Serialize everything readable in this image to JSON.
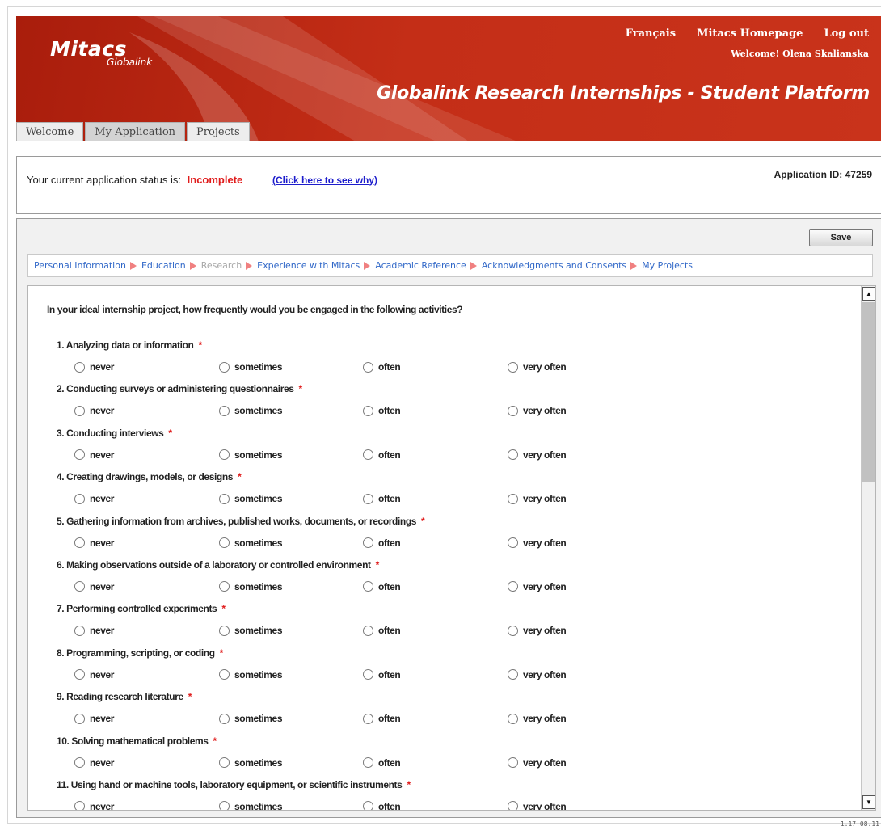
{
  "header": {
    "logo_main": "Mitacs",
    "logo_sub": "Globalink",
    "links": [
      "Français",
      "Mitacs Homepage",
      "Log out"
    ],
    "welcome": "Welcome! Olena Skalianska",
    "platform_title": "Globalink Research Internships - Student Platform",
    "tabs": [
      {
        "label": "Welcome",
        "active": false
      },
      {
        "label": "My Application",
        "active": true
      },
      {
        "label": "Projects",
        "active": false
      }
    ]
  },
  "status": {
    "label": "Your current application status is:",
    "value": "Incomplete",
    "link": "(Click here to see why)",
    "app_id": "Application ID:  47259",
    "status_color": "#e01b1b"
  },
  "toolbar": {
    "save_label": "Save"
  },
  "breadcrumbs": [
    {
      "label": "Personal Information",
      "current": false
    },
    {
      "label": "Education",
      "current": false
    },
    {
      "label": "Research",
      "current": true
    },
    {
      "label": "Experience with Mitacs",
      "current": false
    },
    {
      "label": "Academic Reference",
      "current": false
    },
    {
      "label": "Acknowledgments and Consents",
      "current": false
    },
    {
      "label": "My Projects",
      "current": false
    }
  ],
  "survey": {
    "intro": "In your ideal internship project, how frequently would you be engaged in the following activities?",
    "required_mark": "*",
    "options": [
      "never",
      "sometimes",
      "often",
      "very often"
    ],
    "questions": [
      "1. Analyzing data or information",
      "2. Conducting surveys or administering questionnaires",
      "3. Conducting interviews",
      "4. Creating drawings, models, or designs",
      "5. Gathering information from archives, published works, documents, or recordings",
      "6. Making observations outside of a laboratory or controlled environment",
      "7. Performing controlled experiments",
      "8. Programming, scripting, or coding",
      "9. Reading research literature",
      "10. Solving mathematical problems",
      "11. Using hand or machine tools, laboratory equipment, or scientific instruments"
    ]
  },
  "scrollbar": {
    "up_icon": "▲",
    "down_icon": "▼"
  },
  "version": "1.17.08.11",
  "colors": {
    "brand_red": "#c42e17",
    "link_blue": "#3168c8",
    "required_red": "#e01b1b"
  }
}
